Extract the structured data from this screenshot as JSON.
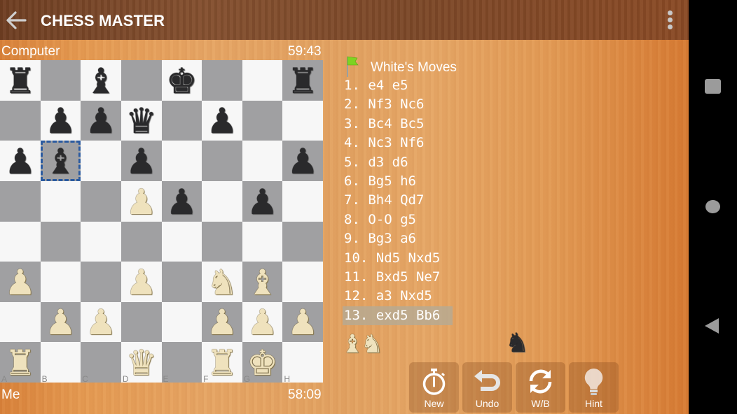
{
  "app": {
    "title": "CHESS MASTER"
  },
  "icons": {
    "back": "arrow-left-icon",
    "menu": "more-vert-icon"
  },
  "players": {
    "top": {
      "name": "Computer",
      "clock": "59:43"
    },
    "bottom": {
      "name": "Me",
      "clock": "58:09"
    }
  },
  "board": {
    "files": [
      "A",
      "B",
      "C",
      "D",
      "E",
      "F",
      "G",
      "H"
    ],
    "selected_square": "b6",
    "light_color": "#f7f7f7",
    "dark_color": "#a0a0a2",
    "pieces": [
      {
        "square": "a8",
        "color": "black",
        "type": "rook",
        "glyph": "♜"
      },
      {
        "square": "c8",
        "color": "black",
        "type": "bishop",
        "glyph": "♝"
      },
      {
        "square": "e8",
        "color": "black",
        "type": "king",
        "glyph": "♚"
      },
      {
        "square": "h8",
        "color": "black",
        "type": "rook",
        "glyph": "♜"
      },
      {
        "square": "b7",
        "color": "black",
        "type": "pawn",
        "glyph": "♟"
      },
      {
        "square": "c7",
        "color": "black",
        "type": "pawn",
        "glyph": "♟"
      },
      {
        "square": "d7",
        "color": "black",
        "type": "queen",
        "glyph": "♛"
      },
      {
        "square": "f7",
        "color": "black",
        "type": "pawn",
        "glyph": "♟"
      },
      {
        "square": "a6",
        "color": "black",
        "type": "pawn",
        "glyph": "♟"
      },
      {
        "square": "b6",
        "color": "black",
        "type": "bishop",
        "glyph": "♝"
      },
      {
        "square": "d6",
        "color": "black",
        "type": "pawn",
        "glyph": "♟"
      },
      {
        "square": "h6",
        "color": "black",
        "type": "pawn",
        "glyph": "♟"
      },
      {
        "square": "d5",
        "color": "white",
        "type": "pawn",
        "glyph": "♟"
      },
      {
        "square": "e5",
        "color": "black",
        "type": "pawn",
        "glyph": "♟"
      },
      {
        "square": "g5",
        "color": "black",
        "type": "pawn",
        "glyph": "♟"
      },
      {
        "square": "a3",
        "color": "white",
        "type": "pawn",
        "glyph": "♟"
      },
      {
        "square": "d3",
        "color": "white",
        "type": "pawn",
        "glyph": "♟"
      },
      {
        "square": "f3",
        "color": "white",
        "type": "knight",
        "glyph": "♞"
      },
      {
        "square": "g3",
        "color": "white",
        "type": "bishop",
        "glyph": "♝"
      },
      {
        "square": "b2",
        "color": "white",
        "type": "pawn",
        "glyph": "♟"
      },
      {
        "square": "c2",
        "color": "white",
        "type": "pawn",
        "glyph": "♟"
      },
      {
        "square": "f2",
        "color": "white",
        "type": "pawn",
        "glyph": "♟"
      },
      {
        "square": "g2",
        "color": "white",
        "type": "pawn",
        "glyph": "♟"
      },
      {
        "square": "h2",
        "color": "white",
        "type": "pawn",
        "glyph": "♟"
      },
      {
        "square": "a1",
        "color": "white",
        "type": "rook",
        "glyph": "♜"
      },
      {
        "square": "d1",
        "color": "white",
        "type": "queen",
        "glyph": "♛"
      },
      {
        "square": "f1",
        "color": "white",
        "type": "rook",
        "glyph": "♜"
      },
      {
        "square": "g1",
        "color": "white",
        "type": "king",
        "glyph": "♚"
      }
    ]
  },
  "moves_panel": {
    "title": "White's Moves",
    "flag_icon": "green-flag-icon",
    "current_index": 12,
    "moves": [
      "1. e4 e5",
      "2. Nf3 Nc6",
      "3. Bc4 Bc5",
      "4. Nc3 Nf6",
      "5. d3 d6",
      "6. Bg5 h6",
      "7. Bh4 Qd7",
      "8. O-O g5",
      "9. Bg3 a6",
      "10. Nd5 Nxd5",
      "11. Bxd5 Ne7",
      "12. a3 Nxd5",
      "13. exd5 Bb6"
    ]
  },
  "captured": {
    "by_black": [
      {
        "type": "bishop",
        "color": "white",
        "glyph": "♝"
      },
      {
        "type": "knight",
        "color": "white",
        "glyph": "♞"
      }
    ],
    "by_white": [
      {
        "type": "knight",
        "color": "black",
        "glyph": "♞"
      }
    ]
  },
  "buttons": [
    {
      "id": "new",
      "label": "New",
      "icon": "stopwatch-icon"
    },
    {
      "id": "undo",
      "label": "Undo",
      "icon": "undo-arrow-icon"
    },
    {
      "id": "wb",
      "label": "W/B",
      "icon": "swap-sides-icon"
    },
    {
      "id": "hint",
      "label": "Hint",
      "icon": "lightbulb-icon"
    }
  ],
  "system_nav": {
    "recents": "recents-icon",
    "home": "home-icon",
    "back": "back-icon"
  }
}
